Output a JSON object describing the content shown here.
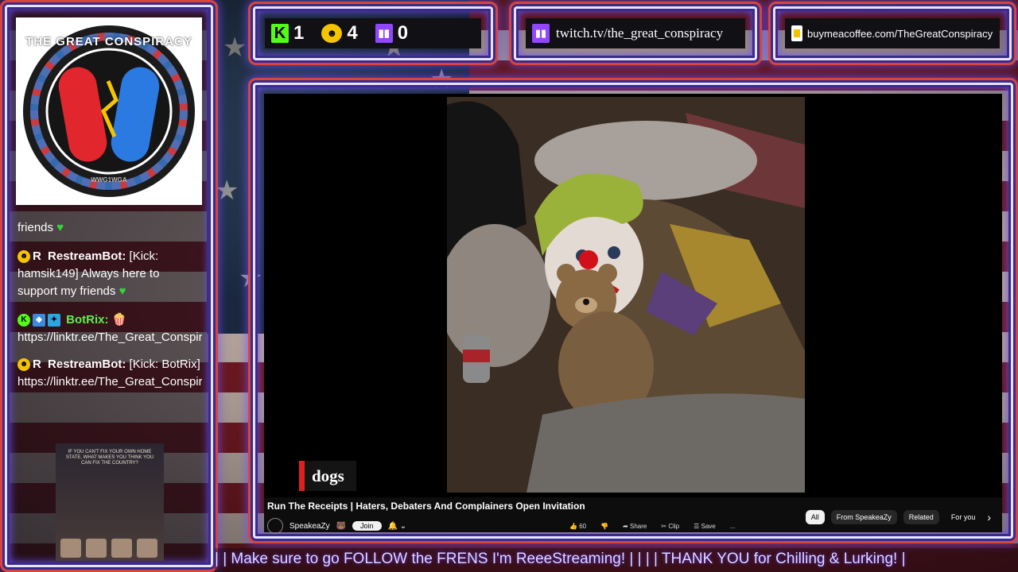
{
  "left_panel": {
    "logo": {
      "title": "THE GREAT CONSPIRACY",
      "motto": "WWG1WGA"
    },
    "chat": [
      {
        "user": "",
        "text": "friends",
        "heart": true
      },
      {
        "user": "RestreamBot:",
        "text": "[Kick: hamsik149] Always here to support my friends",
        "heart": true
      },
      {
        "user": "BotRix:",
        "text": "https://linktr.ee/The_Great_Conspiracy",
        "heart": false
      },
      {
        "user": "RestreamBot:",
        "text": "[Kick: BotRix]",
        "heart": false
      },
      {
        "user": "",
        "text": "https://linktr.ee/The_Great_Conspiracy",
        "heart": false
      }
    ],
    "poster_text": "IF YOU CAN'T FIX YOUR OWN HOME STATE, WHAT MAKES YOU THINK YOU CAN FIX THE COUNTRY?"
  },
  "stats": {
    "kick": "1",
    "rumble": "4",
    "twitch": "0"
  },
  "links": {
    "twitch": "twitch.tv/the_great_conspiracy",
    "coffee": "buymeacoffee.com/TheGreatConspiracy"
  },
  "video": {
    "tag": "dogs",
    "title": "Run The Receipts | Haters, Debaters And Complainers Open Invitation",
    "channel": "SpeakeaZy",
    "join": "Join",
    "actions": [
      "60",
      "",
      "Share",
      "Clip",
      "Save",
      "..."
    ],
    "chips": [
      "All",
      "From SpeakeaZy",
      "Related",
      "For you"
    ]
  },
  "ticker": "| | Make sure to go FOLLOW the FRENS I'm ReeeStreaming! | | | |  THANK YOU for Chilling & Lurking! |"
}
